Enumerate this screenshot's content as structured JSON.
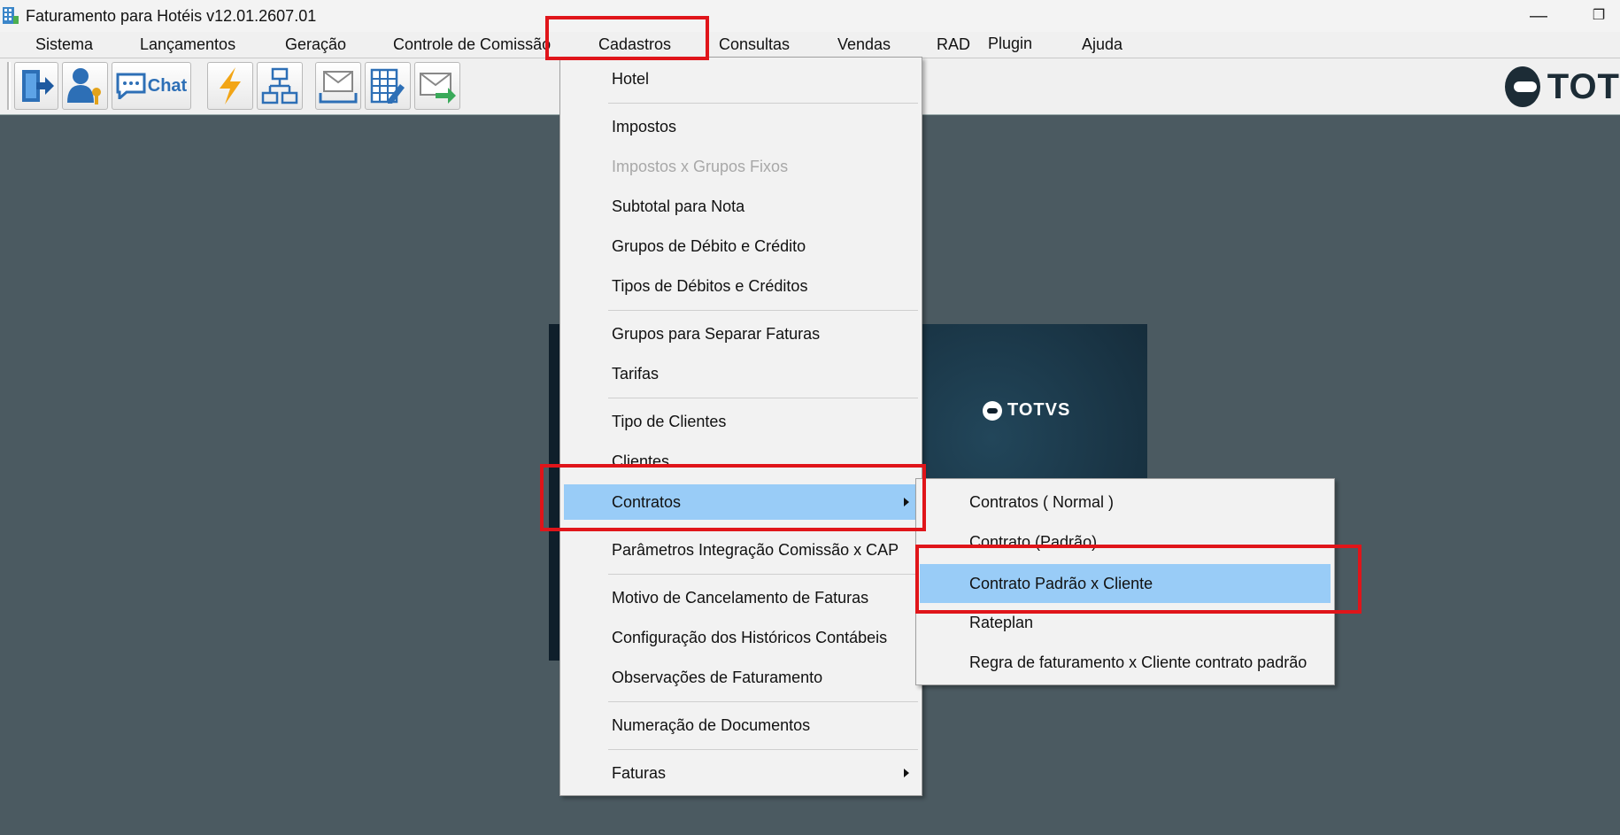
{
  "window": {
    "title": "Faturamento para Hotéis v12.01.2607.01",
    "minimize_glyph": "—",
    "restore_glyph": "❐"
  },
  "menubar": {
    "items": [
      {
        "label": "Sistema"
      },
      {
        "label": "Lançamentos"
      },
      {
        "label": "Geração"
      },
      {
        "label": "Controle de Comissão"
      },
      {
        "label": "Cadastros"
      },
      {
        "label": "Consultas"
      },
      {
        "label": "Vendas"
      },
      {
        "label": "RAD"
      },
      {
        "label": "Plugin"
      },
      {
        "label": "Ajuda"
      }
    ]
  },
  "toolbar": {
    "chat_label": "Chat",
    "icons": [
      "exit-icon",
      "user-key-icon",
      "chat-icon",
      "lightning-icon",
      "org-chart-icon",
      "mail-inbox-icon",
      "calculator-edit-icon",
      "mail-forward-icon"
    ],
    "brand": "TOT"
  },
  "splash": {
    "brand": "TOTVS"
  },
  "cadastros_menu": {
    "items": [
      {
        "label": "Hotel"
      },
      {
        "label": "Impostos"
      },
      {
        "label": "Impostos x Grupos Fixos",
        "disabled": true
      },
      {
        "label": "Subtotal para Nota"
      },
      {
        "label": "Grupos de Débito e Crédito"
      },
      {
        "label": "Tipos de Débitos e Créditos"
      },
      {
        "label": "Grupos para Separar Faturas"
      },
      {
        "label": "Tarifas"
      },
      {
        "label": "Tipo de Clientes"
      },
      {
        "label": "Clientes"
      },
      {
        "label": "Contratos",
        "selected": true,
        "has_submenu": true
      },
      {
        "label": "Parâmetros Integração Comissão x CAP"
      },
      {
        "label": "Motivo de Cancelamento de Faturas"
      },
      {
        "label": "Configuração dos Históricos Contábeis"
      },
      {
        "label": "Observações de Faturamento"
      },
      {
        "label": "Numeração de Documentos"
      },
      {
        "label": "Faturas",
        "has_submenu": true
      }
    ]
  },
  "contratos_submenu": {
    "items": [
      {
        "label": "Contratos ( Normal )"
      },
      {
        "label": "Contrato (Padrão)"
      },
      {
        "label": "Contrato Padrão x Cliente",
        "selected": true
      },
      {
        "label": "Rateplan"
      },
      {
        "label": "Regra de faturamento x Cliente contrato padrão"
      }
    ]
  },
  "colors": {
    "highlight_box": "#e0151a",
    "selection": "#99ccf7",
    "desktop": "#4b5a61"
  }
}
